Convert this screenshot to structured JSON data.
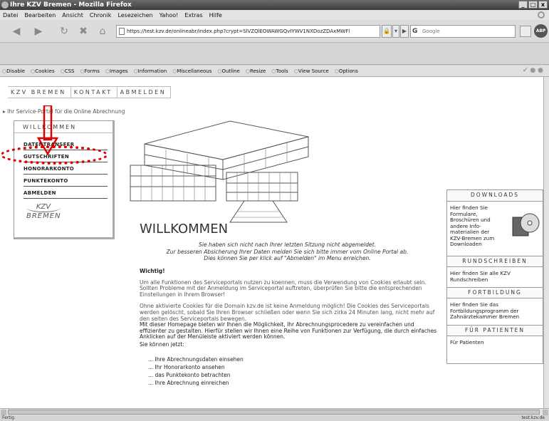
{
  "window": {
    "title": "Ihre KZV Bremen - Mozilla Firefox",
    "controls": [
      "_",
      "□",
      "x"
    ]
  },
  "menu": [
    "Datei",
    "Bearbeiten",
    "Ansicht",
    "Chronik",
    "Lesezeichen",
    "Yahoo!",
    "Extras",
    "Hilfe"
  ],
  "navbar": {
    "url": "https://test.kzv.de/onlineabr/index.php?crypt=SlVZQlEOWAWGQvIYWV1NXDozZDAxMWFl",
    "search_placeholder": "Google",
    "search_engine_icon": "G",
    "adblock_label": "ABP"
  },
  "devbar": [
    "Disable",
    "Cookies",
    "CSS",
    "Forms",
    "Images",
    "Information",
    "Miscellaneous",
    "Outline",
    "Resize",
    "Tools",
    "View Source",
    "Options"
  ],
  "site": {
    "topnav": [
      "KZV BREMEN",
      "KONTAKT",
      "ABMELDEN"
    ],
    "breadcrumb": "Ihr Service-Portal für die Online Abrechnung",
    "leftnav": {
      "heading": "WILLKOMMEN",
      "items": [
        "DATENTRANSFER",
        "GUTSCHRIFTEN",
        "HONORARKONTO",
        "PUNKTEKONTO",
        "ABMELDEN"
      ],
      "logo_top": "KZV",
      "logo_bottom": "BREMEN"
    },
    "main": {
      "title": "WILLKOMMEN",
      "welcome": [
        "Sie haben sich nicht nach Ihrer letzten Sitzung nicht abgemeldet.",
        "Zur besseren Absicherung Ihrer Daten melden Sie sich bitte immer vom Online Portal ab.",
        "Dies können Sie per klick auf \"Abmelden\" im Menu erreichen."
      ],
      "important_heading": "Wichtig!",
      "para1": "Um alle Funktionen des Serviceportals nutzen zu koennen, muss die Verwendung von Cookies erlaubt sein. Sollten Probleme mit der Anmeldung im Serviceportal auftreten, überprüfen Sie bitte die entsprechenden Einstellungen in Ihrem Browser!",
      "para2": "Ohne aktivierte Cookies für die Domain kzv.de ist keine Anmeldung möglich! Die Cookies des Serviceportals werden gelöscht, sobald Sie Ihren Browser schließen oder wenn Sie sich zirka 24 Minuten lang, nicht mehr auf den seiten des Serviceportals bewegen.",
      "para3": "Mit dieser Homepage bieten wir Ihnen die Möglichkeit, Ihr Abrechnungsprocedere zu vereinfachen und effizienter zu gestalten. Hierfür stellen wir Ihnen eine Reihe von Funktionen zur Verfügung, die durch einfaches Anklicken auf der Menüleiste aktiviert werden können.",
      "you_can": "Sie können jetzt:",
      "list": [
        "... Ihre Abrechnungsdaten einsehen",
        "... Ihr Honorarkonto ansehen",
        "... das Punktekonto betrachten",
        "... Ihre Abrechnung einreichen"
      ]
    },
    "right": [
      {
        "heading": "DOWNLOADS",
        "text": "Hier finden Sie Formulare, Broschüren und andere Info-materialien der KZV-Bremen zum Downloaden"
      },
      {
        "heading": "RUNDSCHREIBEN",
        "text": "Hier finden Sie alle KZV Rundschreiben"
      },
      {
        "heading": "FORTBILDUNG",
        "text": "Hier finden Sie das Fortbildungsprogramm der Zahnärztekammer Bremen"
      },
      {
        "heading": "FÜR PATIENTEN",
        "text": "Für Patienten"
      }
    ]
  },
  "status": {
    "left": "Fertig",
    "right": "test.kzv.de"
  },
  "colors": {
    "annotation_red": "#e00000",
    "titlebar": "#3c3c3c"
  }
}
